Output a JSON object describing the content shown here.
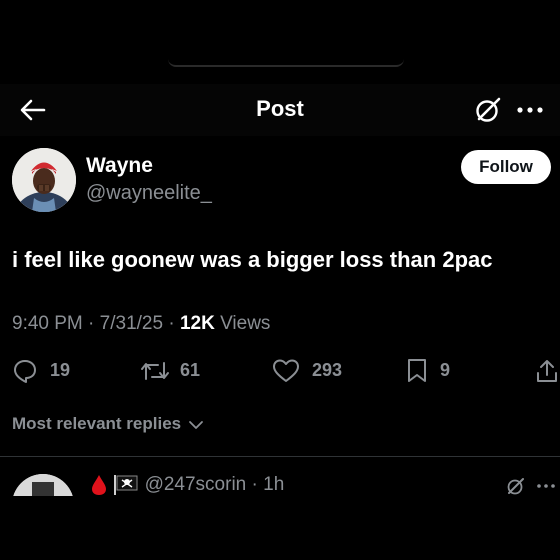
{
  "header": {
    "title": "Post",
    "icons": {
      "back": "arrow-left-icon",
      "grok": "grok-icon",
      "more": "more-horizontal-icon"
    }
  },
  "author": {
    "name": "Wayne",
    "handle": "@wayneelite_",
    "follow_label": "Follow",
    "avatar": "user-avatar"
  },
  "post": {
    "text": "i feel like goonew was a bigger loss than 2pac",
    "time": "9:40 PM",
    "date": "7/31/25",
    "views_count": "12K",
    "views_label": "Views"
  },
  "actions": {
    "replies": {
      "icon": "reply-icon",
      "count": "19"
    },
    "reposts": {
      "icon": "repost-icon",
      "count": "61"
    },
    "likes": {
      "icon": "heart-icon",
      "count": "293"
    },
    "bookmarks": {
      "icon": "bookmark-icon",
      "count": "9"
    },
    "share": {
      "icon": "share-icon"
    }
  },
  "replies_sort": {
    "label": "Most relevant replies",
    "icon": "chevron-down-icon"
  },
  "reply": {
    "handle": "@247scorin",
    "time": "1h",
    "badges": [
      "blood-drop-icon",
      "pirate-flag-icon"
    ]
  },
  "colors": {
    "background": "#000000",
    "text": "#ffffff",
    "muted": "#8b8f94",
    "blood": "#e0121b"
  }
}
